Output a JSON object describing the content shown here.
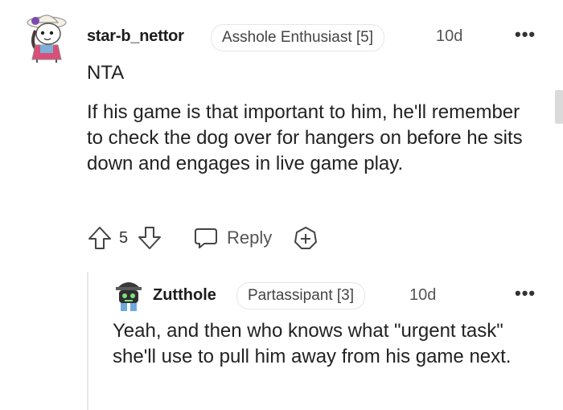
{
  "comment": {
    "username": "star-b_nettor",
    "flair": "Asshole Enthusiast [5]",
    "time": "10d",
    "verdict": "NTA",
    "body": "If his game is that important to him, he'll remember to check the dog over for hangers on before he sits down and engages in live game play.",
    "score": "5",
    "reply_label": "Reply",
    "more": "•••"
  },
  "reply": {
    "username": "Zutthole",
    "flair": "Partassipant [3]",
    "time": "10d",
    "body": "Yeah, and then who knows what \"urgent task\" she'll use to pull him away from his game next.",
    "more": "•••"
  },
  "icons": {
    "upvote": "upvote-arrow-icon",
    "downvote": "downvote-arrow-icon",
    "reply": "speech-bubble-icon",
    "award": "award-plus-icon",
    "more": "horizontal-ellipsis-icon"
  }
}
